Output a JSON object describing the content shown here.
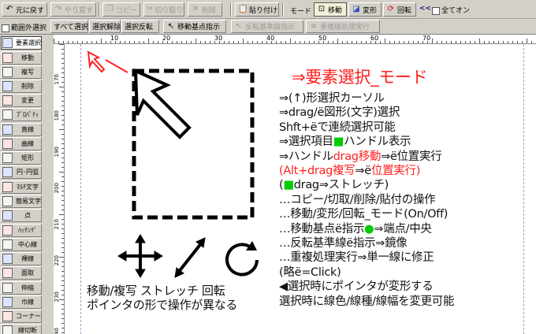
{
  "toolbar1": {
    "undo": "元に戻す",
    "redo": "やり直す",
    "copy": "コピー",
    "cut": "切り取り",
    "delete": "削除",
    "paste": "貼り付け",
    "mode_label": "モード",
    "move": "移動",
    "transform": "変形",
    "rotate": "回転",
    "chevrons": "<<",
    "all_on": "全てオン"
  },
  "toolbar2": {
    "out_of_range": "範囲外選択",
    "select_all": "すべて選択",
    "deselect": "選択解除",
    "invert": "選択反転",
    "move_base": "移動基点指示",
    "mirror_base": "反転基準線指示",
    "overlap": "重複線処理実行"
  },
  "palette": [
    {
      "label": "要素選択",
      "icon": "cursor-icon"
    },
    {
      "label": "移動",
      "icon": "move-icon"
    },
    {
      "label": "複写",
      "icon": "copy-icon"
    },
    {
      "label": "削除",
      "icon": "eraser-icon"
    },
    {
      "label": "変更",
      "icon": "change-icon"
    },
    {
      "label": "ﾌﾟﾛﾊﾟﾃｨ",
      "icon": "property-icon"
    },
    {
      "label": "直線",
      "icon": "line-icon"
    },
    {
      "label": "曲線",
      "icon": "curve-icon"
    },
    {
      "label": "矩形",
      "icon": "rect-icon"
    },
    {
      "label": "円･円弧",
      "icon": "circle-icon"
    },
    {
      "label": "ﾏﾙﾁ文字",
      "icon": "text-multi-icon"
    },
    {
      "label": "簡易文字",
      "icon": "text-simple-icon"
    },
    {
      "label": "点",
      "icon": "point-icon"
    },
    {
      "label": "ﾊｯﾁﾝｸﾞ",
      "icon": "hatch-icon"
    },
    {
      "label": "中心線",
      "icon": "centerline-icon"
    },
    {
      "label": "裸線",
      "icon": "bareline-icon"
    },
    {
      "label": "面取",
      "icon": "chamfer-icon"
    },
    {
      "label": "伸縮",
      "icon": "stretch-icon"
    },
    {
      "label": "巾線",
      "icon": "widthline-icon"
    },
    {
      "label": "コーナー",
      "icon": "corner-icon"
    },
    {
      "label": "線切断",
      "icon": "cut-line-icon"
    }
  ],
  "ruler_h": [
    "10",
    "20",
    "30",
    "40",
    "50",
    "60",
    "70"
  ],
  "ruler_v": [
    "170",
    "180",
    "190",
    "200",
    "210",
    "220",
    "230",
    "240"
  ],
  "help": {
    "title": "⇒要素選択_モード",
    "lines": [
      [
        {
          "t": "⇒(↑)形選択カーソル",
          "c": "blk"
        }
      ],
      [
        {
          "t": "⇒drag/",
          "c": "blk"
        },
        {
          "t": "ë",
          "c": "blk"
        },
        {
          "t": "図形(文字)選択",
          "c": "blk"
        }
      ],
      [
        {
          "t": "Shft+",
          "c": "blk"
        },
        {
          "t": "ë",
          "c": "blk"
        },
        {
          "t": "で連続選択可能",
          "c": "blk"
        }
      ],
      [
        {
          "t": "⇒選択項目",
          "c": "blk"
        },
        {
          "t": "■",
          "c": "grn"
        },
        {
          "t": "ハンドル表示",
          "c": "blk"
        }
      ],
      [
        {
          "t": "⇒ハンドル",
          "c": "blk"
        },
        {
          "t": "drag移動",
          "c": "red"
        },
        {
          "t": "⇒",
          "c": "blk"
        },
        {
          "t": "ë",
          "c": "blk"
        },
        {
          "t": "位置実行",
          "c": "blk"
        }
      ],
      [
        {
          "t": "(Alt+drag複写",
          "c": "red"
        },
        {
          "t": "⇒",
          "c": "blk"
        },
        {
          "t": "ë",
          "c": "blk"
        },
        {
          "t": "位置実行)",
          "c": "red"
        }
      ],
      [
        {
          "t": "(",
          "c": "blk"
        },
        {
          "t": "■",
          "c": "grn"
        },
        {
          "t": "drag⇒ストレッチ)",
          "c": "blk"
        }
      ],
      [
        {
          "t": "…コピー/切取/削除/貼付の操作",
          "c": "blk"
        }
      ],
      [
        {
          "t": "…移動/変形/回転_モード(On/Off)",
          "c": "blk"
        }
      ],
      [
        {
          "t": "…移動基点",
          "c": "blk"
        },
        {
          "t": "ë",
          "c": "blk"
        },
        {
          "t": "指示",
          "c": "blk"
        },
        {
          "t": "●",
          "c": "grn"
        },
        {
          "t": "⇒端点/中央",
          "c": "blk"
        }
      ],
      [
        {
          "t": "…反転基準線",
          "c": "blk"
        },
        {
          "t": "ë",
          "c": "blk"
        },
        {
          "t": "指示⇒鏡像",
          "c": "blk"
        }
      ],
      [
        {
          "t": "…重複処理実行⇒単一線に修正",
          "c": "blk"
        }
      ],
      [
        {
          "t": "(略",
          "c": "blk"
        },
        {
          "t": "ë",
          "c": "blk"
        },
        {
          "t": "=Click)",
          "c": "blk"
        }
      ],
      [
        {
          "t": "◀選択時にポインタが変形する",
          "c": "blk"
        }
      ],
      [
        {
          "t": "選択時に線色/線種/線幅を変更可能",
          "c": "blk"
        }
      ]
    ]
  },
  "caption": {
    "line1": "移動/複写 ストレッチ 回転",
    "line2": "ポインタの形で操作が異なる"
  },
  "colors": {
    "accent_red": "#ff2020",
    "accent_green": "#00cc00",
    "guide": "#9aa0cc"
  }
}
